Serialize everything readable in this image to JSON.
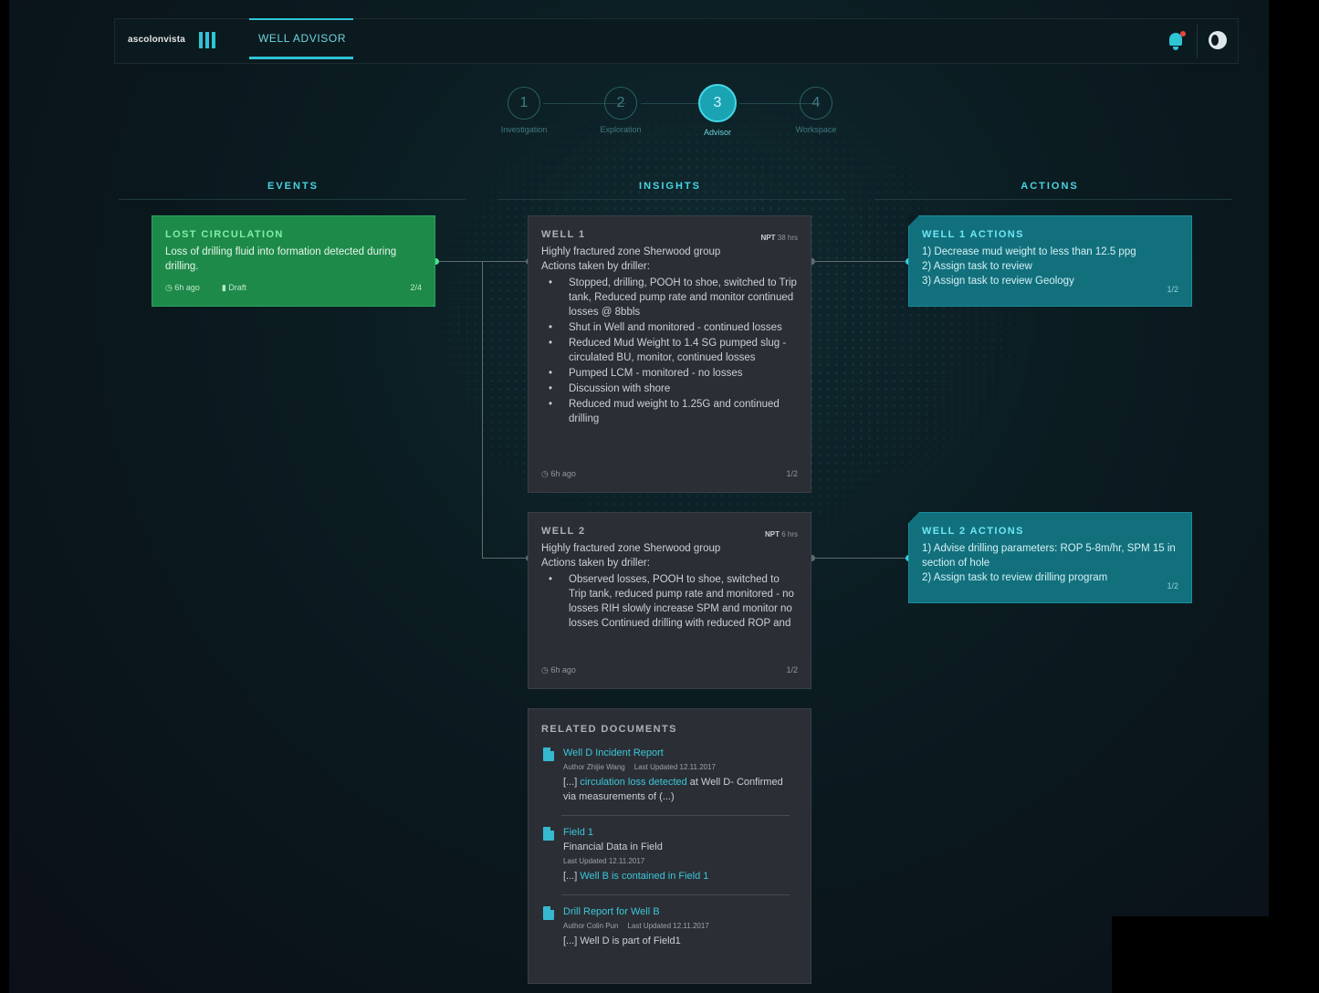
{
  "header": {
    "logo_text": "ascolonvista",
    "nav_tab": "WELL ADVISOR"
  },
  "stepper": [
    {
      "number": "1",
      "label": "Investigation"
    },
    {
      "number": "2",
      "label": "Exploration"
    },
    {
      "number": "3",
      "label": "Advisor"
    },
    {
      "number": "4",
      "label": "Workspace"
    }
  ],
  "columns": {
    "events": "EVENTS",
    "insights": "INSIGHTS",
    "actions": "ACTIONS"
  },
  "event": {
    "title": "LOST CIRCULATION",
    "description": "Loss of drilling fluid into formation detected during drilling.",
    "time": "6h ago",
    "status": "Draft",
    "count": "2/4"
  },
  "insights": [
    {
      "title": "WELL 1",
      "npt_label": "NPT",
      "npt_value": "38 hrs",
      "line1": "Highly fractured zone Sherwood group",
      "line2": "Actions taken by driller:",
      "bullets": [
        "Stopped, drilling, POOH to shoe, switched to Trip tank, Reduced pump rate and monitor continued losses @ 8bbls",
        "Shut in Well and monitored - continued losses",
        "Reduced Mud Weight to 1.4 SG pumped slug - circulated BU, monitor, continued losses",
        "Pumped LCM - monitored - no losses",
        "Discussion with shore",
        "Reduced mud weight to 1.25G and continued drilling"
      ],
      "time": "6h ago",
      "count": "1/2"
    },
    {
      "title": "WELL 2",
      "npt_label": "NPT",
      "npt_value": "6 hrs",
      "line1": "Highly fractured zone Sherwood group",
      "line2": "Actions taken by driller:",
      "bullets": [
        "Observed losses, POOH to shoe, switched to Trip tank, reduced pump rate and monitored - no losses RIH slowly increase SPM and monitor no losses Continued drilling with reduced ROP and"
      ],
      "time": "6h ago",
      "count": "1/2"
    }
  ],
  "actions": [
    {
      "title": "WELL 1 ACTIONS",
      "lines": [
        "1) Decrease mud weight to less than 12.5 ppg",
        "2) Assign task to review",
        "3) Assign task to review Geology"
      ],
      "count": "1/2"
    },
    {
      "title": "WELL 2 ACTIONS",
      "lines": [
        "1) Advise drilling parameters: ROP 5-8m/hr, SPM 15 in section of hole",
        "2) Assign task to review drilling program"
      ],
      "count": "1/2"
    }
  ],
  "related_documents": {
    "title": "RELATED DOCUMENTS",
    "docs": [
      {
        "name": "Well D Incident Report",
        "author": "Author Zhijie Wang",
        "updated": "Last Updated 12.11.2017",
        "snippet_pre": "[...] ",
        "snippet_link": "circulation loss detected",
        "snippet_post": " at Well D- Confirmed via measurements of (...)"
      },
      {
        "name": "Field 1",
        "subtitle": "Financial Data in Field",
        "updated": "Last Updated 12.11.2017",
        "snippet_pre": "[...] ",
        "snippet_link": "Well B is contained in Field 1",
        "snippet_post": ""
      },
      {
        "name": "Drill Report for Well B",
        "author": "Author Colin Pun",
        "updated": "Last Updated 12.11.2017",
        "snippet_pre": "[...] Well D is part of Field1",
        "snippet_link": "",
        "snippet_post": ""
      }
    ]
  },
  "colors": {
    "accent": "#2ec5d6",
    "event_green": "#1e8a4a",
    "action_teal": "#12707d",
    "insight_gray": "#2b2f35",
    "notification": "#e8463c"
  }
}
